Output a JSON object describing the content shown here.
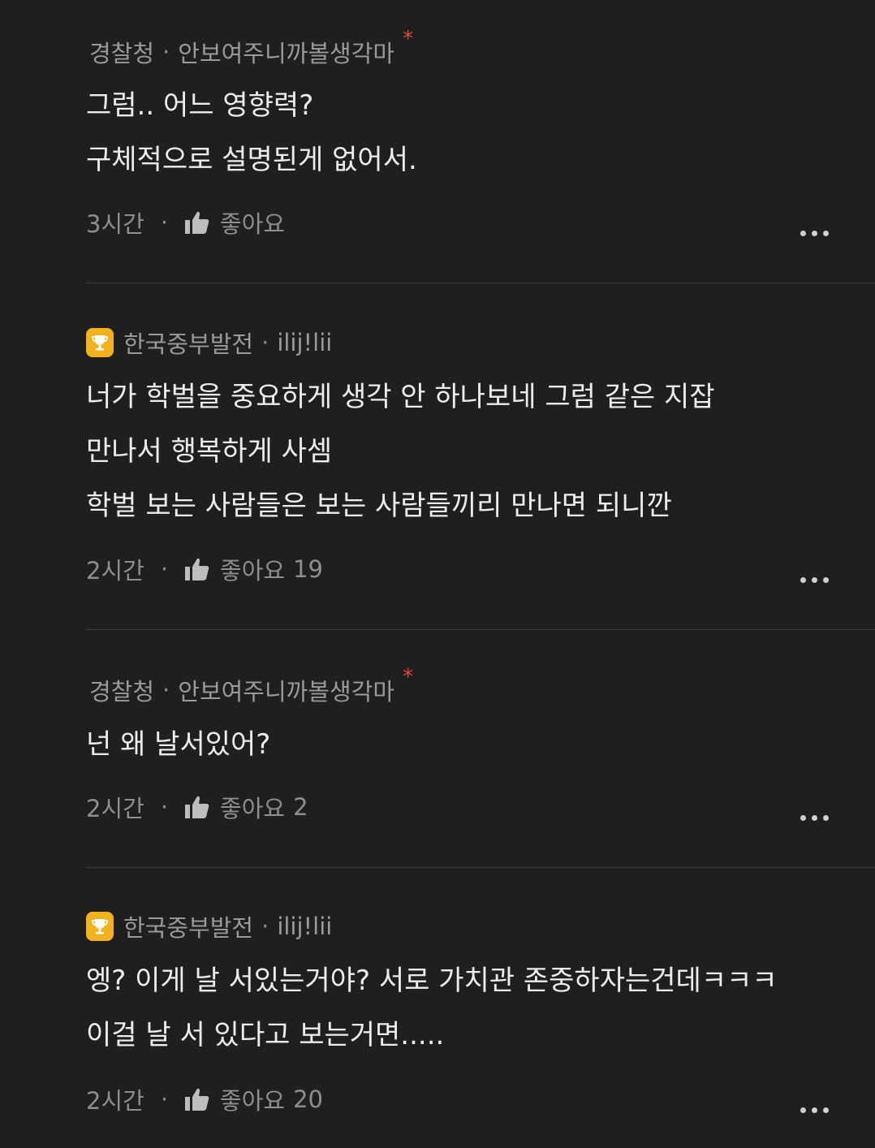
{
  "comments": [
    {
      "author": "경찰청",
      "nickname": "안보여주니까볼생각마",
      "author_mark": "*",
      "has_badge": false,
      "lines": [
        "그럼.. 어느 영향력?",
        "구체적으로 설명된게 없어서."
      ],
      "time": "3시간",
      "like_label": "좋아요",
      "like_count": ""
    },
    {
      "author": "한국중부발전",
      "nickname": "ilij!lii",
      "author_mark": "",
      "has_badge": true,
      "lines": [
        "너가 학벌을 중요하게 생각 안 하나보네 그럼 같은 지잡",
        "만나서 행복하게 사셈",
        "학벌 보는 사람들은 보는 사람들끼리 만나면 되니깐"
      ],
      "time": "2시간",
      "like_label": "좋아요",
      "like_count": "19"
    },
    {
      "author": "경찰청",
      "nickname": "안보여주니까볼생각마",
      "author_mark": "*",
      "has_badge": false,
      "lines": [
        "넌 왜 날서있어?"
      ],
      "time": "2시간",
      "like_label": "좋아요",
      "like_count": "2"
    },
    {
      "author": "한국중부발전",
      "nickname": "ilij!lii",
      "author_mark": "",
      "has_badge": true,
      "lines": [
        "엥? 이게 날 서있는거야? 서로 가치관 존중하자는건데ㅋㅋㅋ",
        "이걸 날 서 있다고 보는거면....."
      ],
      "time": "2시간",
      "like_label": "좋아요",
      "like_count": "20"
    }
  ],
  "separator": "·",
  "icons": {
    "badge": "trophy-icon",
    "like": "thumbs-up-icon",
    "more": "more-options-icon"
  },
  "colors": {
    "background": "#1f1f1f",
    "badge": "#f3b21d",
    "author_mark": "#e04343"
  }
}
